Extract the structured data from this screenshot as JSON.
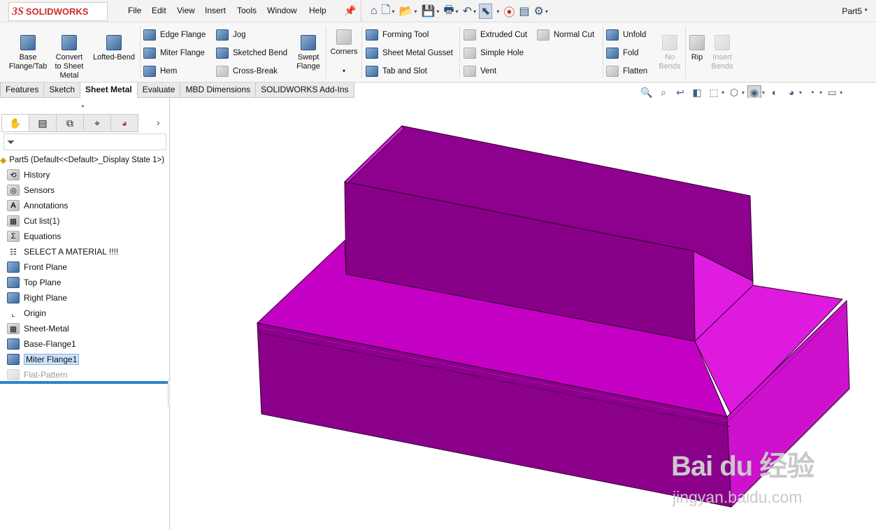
{
  "app": {
    "logo_prefix": "3S",
    "logo_text": "SOLIDWORKS",
    "document_title": "Part5 *"
  },
  "menu": [
    "File",
    "Edit",
    "View",
    "Insert",
    "Tools",
    "Window",
    "Help"
  ],
  "ribbon": {
    "base_flange": "Base\nFlange/Tab",
    "convert": "Convert\nto Sheet\nMetal",
    "lofted_bend": "Lofted-Bend",
    "edge_flange": "Edge Flange",
    "miter_flange": "Miter Flange",
    "hem": "Hem",
    "jog": "Jog",
    "sketched_bend": "Sketched Bend",
    "cross_break": "Cross-Break",
    "swept_flange": "Swept\nFlange",
    "corners": "Corners",
    "forming_tool": "Forming Tool",
    "gusset": "Sheet Metal Gusset",
    "tab_slot": "Tab and Slot",
    "extruded_cut": "Extruded Cut",
    "simple_hole": "Simple Hole",
    "vent": "Vent",
    "normal_cut": "Normal Cut",
    "unfold": "Unfold",
    "fold": "Fold",
    "flatten": "Flatten",
    "no_bends": "No\nBends",
    "rip": "Rip",
    "insert_bends": "Insert\nBends"
  },
  "tabs": [
    "Features",
    "Sketch",
    "Sheet Metal",
    "Evaluate",
    "MBD Dimensions",
    "SOLIDWORKS Add-Ins"
  ],
  "active_tab": "Sheet Metal",
  "tree": {
    "root": "Part5  (Default<<Default>_Display State 1>)",
    "items": [
      {
        "label": "History",
        "icon": "history-icon"
      },
      {
        "label": "Sensors",
        "icon": "sensor-icon"
      },
      {
        "label": "Annotations",
        "icon": "annotations-icon"
      },
      {
        "label": "Cut list(1)",
        "icon": "cut-list-icon"
      },
      {
        "label": "Equations",
        "icon": "equations-icon"
      },
      {
        "label": "SELECT A MATERIAL !!!!",
        "icon": "material-icon"
      },
      {
        "label": "Front Plane",
        "icon": "plane-icon"
      },
      {
        "label": "Top Plane",
        "icon": "plane-icon"
      },
      {
        "label": "Right Plane",
        "icon": "plane-icon"
      },
      {
        "label": "Origin",
        "icon": "origin-icon"
      },
      {
        "label": "Sheet-Metal",
        "icon": "sheet-metal-icon"
      },
      {
        "label": "Base-Flange1",
        "icon": "base-flange-icon"
      },
      {
        "label": "Miter Flange1",
        "icon": "miter-flange-icon",
        "selected": true
      },
      {
        "label": "Flat-Pattern",
        "icon": "flat-pattern-icon",
        "muted": true
      }
    ]
  },
  "model": {
    "color": "#c200c2"
  },
  "watermark": {
    "brand": "Bai du 经验",
    "site": "jingyan.baidu.com"
  }
}
